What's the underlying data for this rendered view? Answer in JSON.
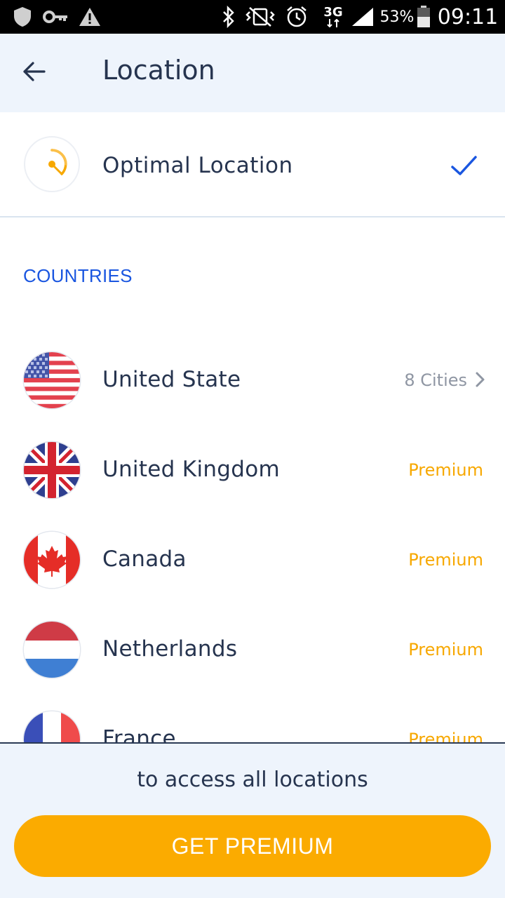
{
  "status_bar": {
    "battery": "53%",
    "network": "3G",
    "time": "09:11",
    "icons": [
      "shield-icon",
      "key-icon",
      "warning-icon",
      "bluetooth-icon",
      "vibrate-icon",
      "alarm-icon",
      "network-3g-icon",
      "signal-icon",
      "battery-icon"
    ]
  },
  "header": {
    "title": "Location",
    "back_icon": "arrow-left-icon"
  },
  "optimal": {
    "label": "Optimal Location",
    "icon": "optimal-location-icon",
    "selected_icon": "checkmark-icon",
    "selected": true
  },
  "countries": {
    "section_title": "COUNTRIES",
    "items": [
      {
        "name": "United State",
        "detail": "8 Cities",
        "flag": "us-flag-icon",
        "premium": false
      },
      {
        "name": "United Kingdom",
        "detail": "Premium",
        "flag": "uk-flag-icon",
        "premium": true
      },
      {
        "name": "Canada",
        "detail": "Premium",
        "flag": "canada-flag-icon",
        "premium": true
      },
      {
        "name": "Netherlands",
        "detail": "Premium",
        "flag": "netherlands-flag-icon",
        "premium": true
      },
      {
        "name": "France",
        "detail": "Premium",
        "flag": "france-flag-icon",
        "premium": true
      }
    ]
  },
  "footer": {
    "message": "to access all locations",
    "button_label": "GET PREMIUM"
  },
  "colors": {
    "accent_blue": "#1a56e0",
    "premium_orange": "#f7a800",
    "button_orange": "#fbab00",
    "header_bg": "#eef4fc",
    "text_dark": "#26344f"
  }
}
